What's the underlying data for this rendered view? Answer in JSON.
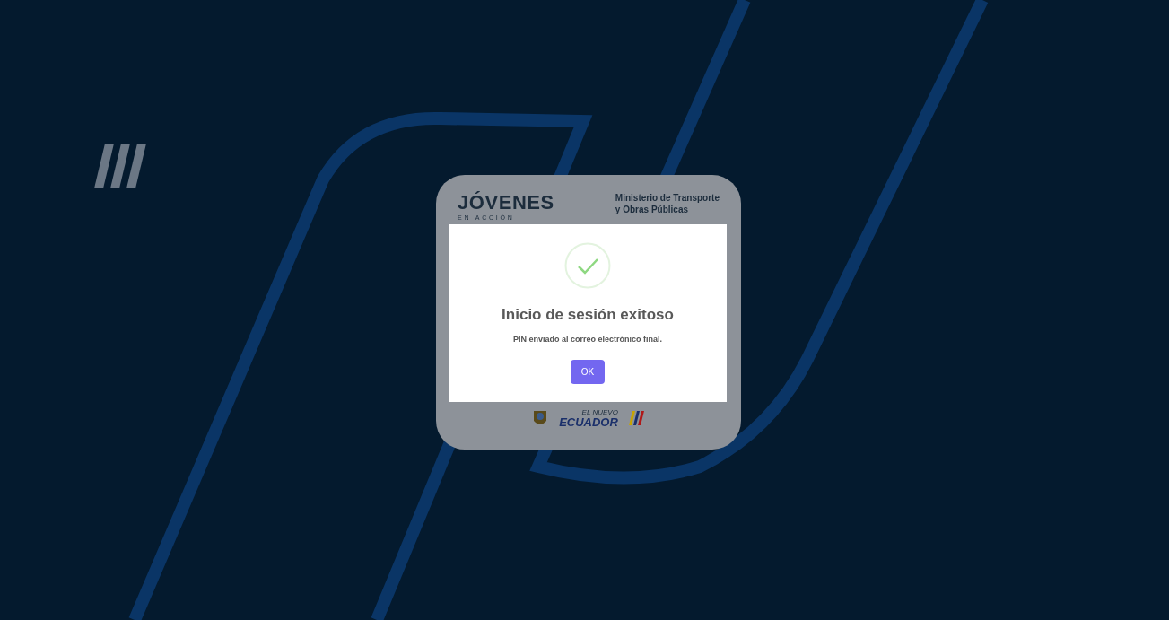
{
  "card": {
    "logo": {
      "title": "JÓVENES",
      "subtitle": "EN ACCIÓN"
    },
    "ministry": [
      "Ministerio de Transporte",
      "y Obras Públicas"
    ],
    "footer_logo": {
      "small": "EL NUEVO",
      "name": "ECUADOR"
    }
  },
  "dialog": {
    "title": "Inicio de sesión exitoso",
    "message": "PIN enviado al correo electrónico final.",
    "button": "OK"
  }
}
